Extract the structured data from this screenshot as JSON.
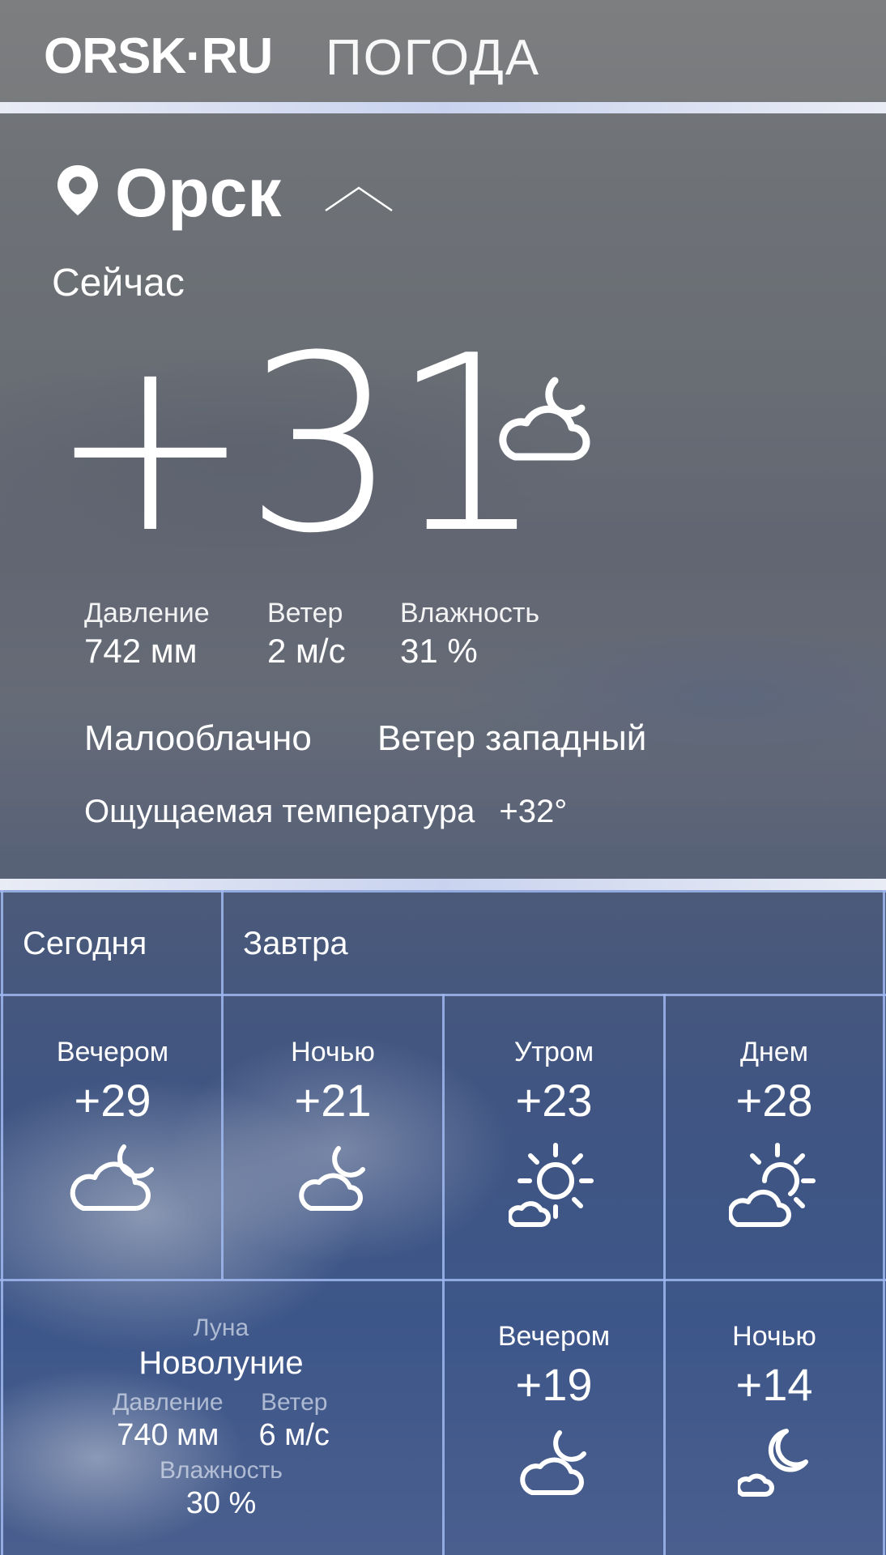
{
  "header": {
    "logo": "ORSK·RU",
    "section": "ПОГОДА"
  },
  "current": {
    "city": "Орск",
    "now_label": "Сейчас",
    "temperature": "+31",
    "icon": "partly-cloudy-night-icon",
    "metrics": [
      {
        "label": "Давление",
        "value": "742 мм"
      },
      {
        "label": "Ветер",
        "value": "2 м/с"
      },
      {
        "label": "Влажность",
        "value": "31 %"
      }
    ],
    "condition": "Малооблачно",
    "wind_direction": "Ветер западный",
    "feels_label": "Ощущаемая температура",
    "feels_value": "+32°"
  },
  "tabs": [
    {
      "label": "Сегодня"
    },
    {
      "label": "Завтра"
    }
  ],
  "forecast_row1": [
    {
      "label": "Вечером",
      "temp": "+29",
      "icon": "partly-cloudy-night-icon"
    },
    {
      "label": "Ночью",
      "temp": "+21",
      "icon": "partly-cloudy-night-icon"
    },
    {
      "label": "Утром",
      "temp": "+23",
      "icon": "sun-with-cloud-icon"
    },
    {
      "label": "Днем",
      "temp": "+28",
      "icon": "sun-behind-cloud-icon"
    }
  ],
  "moon": {
    "label": "Луна",
    "phase": "Новолуние",
    "pressure_label": "Давление",
    "pressure_value": "740 мм",
    "wind_label": "Ветер",
    "wind_value": "6 м/с",
    "humidity_label": "Влажность",
    "humidity_value": "30 %"
  },
  "forecast_row2": [
    {
      "label": "Вечером",
      "temp": "+19",
      "icon": "partly-cloudy-night-icon"
    },
    {
      "label": "Ночью",
      "temp": "+14",
      "icon": "moon-with-cloud-icon"
    }
  ]
}
